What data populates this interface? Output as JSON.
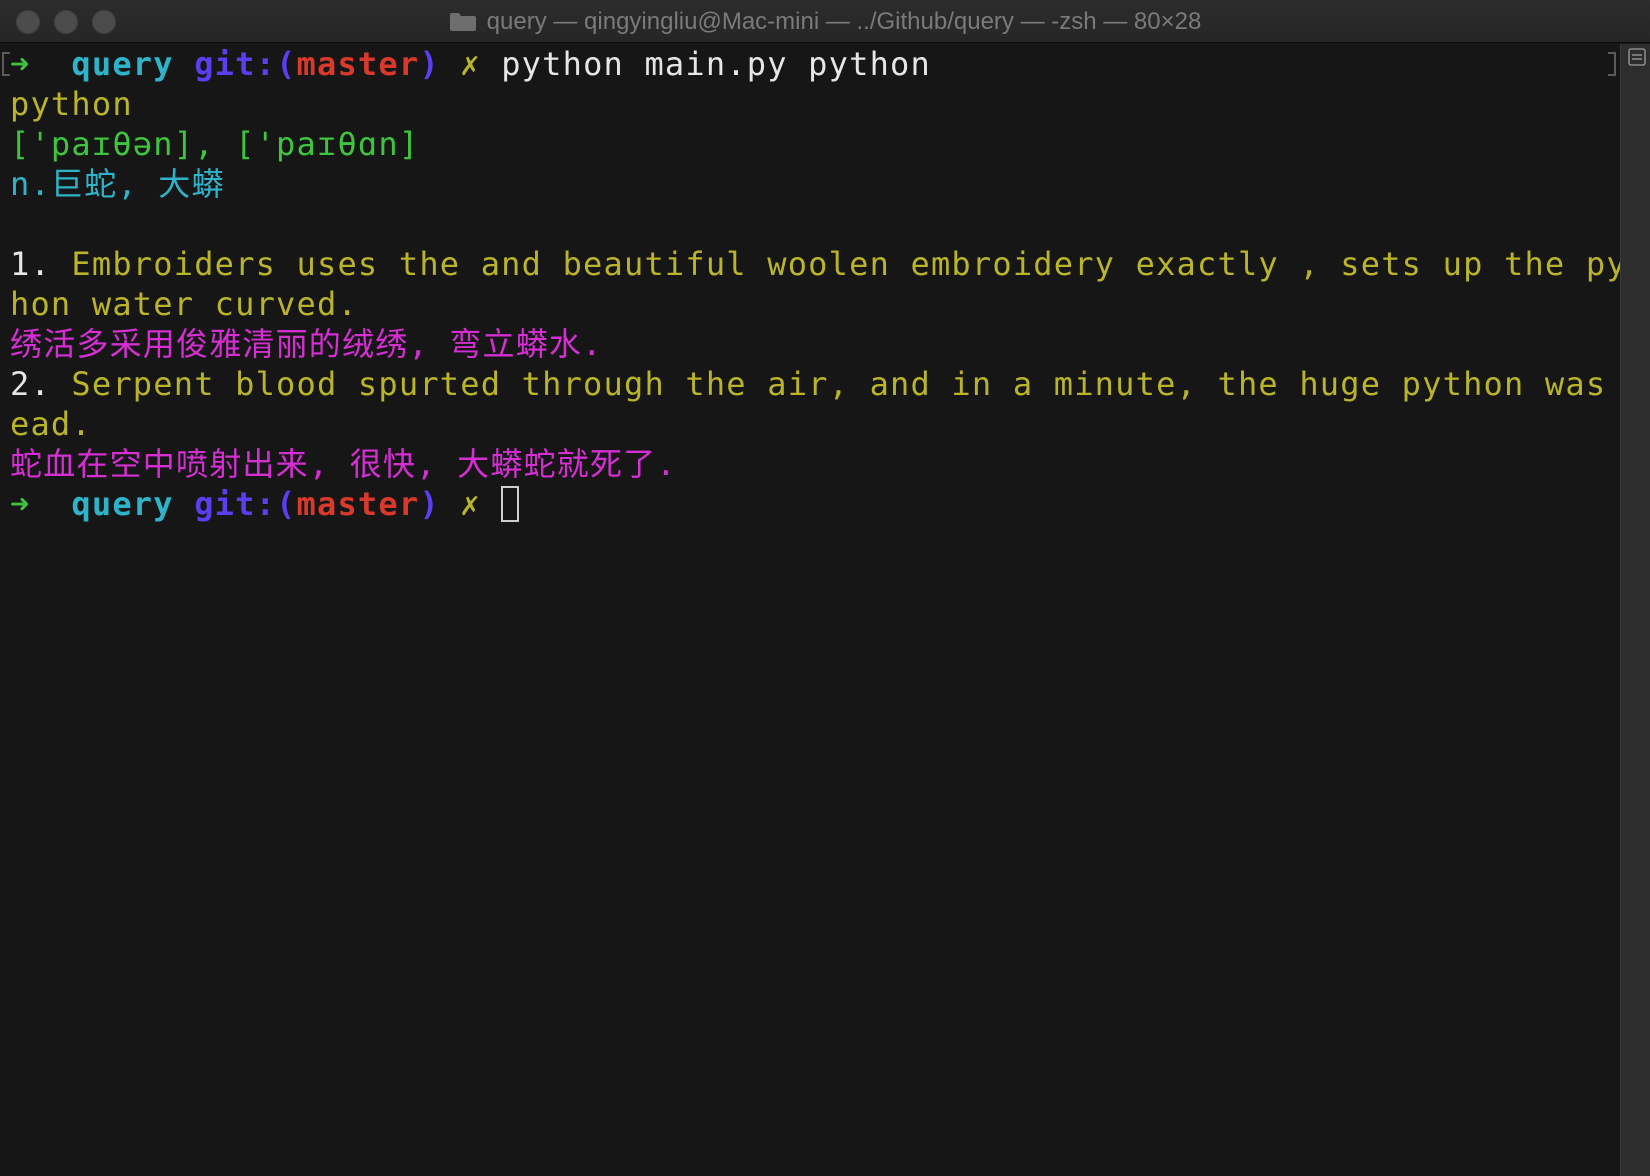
{
  "window": {
    "title": "query — qingyingliu@Mac-mini — ../Github/query — -zsh — 80×28"
  },
  "icons": {
    "folder": "folder-icon",
    "marks": "marks-icon"
  },
  "colors": {
    "background": "#161616",
    "green": "#3ec43e",
    "cyan": "#2fb3c9",
    "blue": "#5a3ef0",
    "red": "#d8392b",
    "yellow": "#b9b42a",
    "magenta": "#d52fd3",
    "white": "#e6e6e6"
  },
  "terminal": {
    "lines": [
      [
        {
          "text": "➜  ",
          "color": "#3ec43e",
          "bold": true
        },
        {
          "text": "query ",
          "color": "#2fb3c9",
          "bold": true
        },
        {
          "text": "git:(",
          "color": "#5a3ef0",
          "bold": true
        },
        {
          "text": "master",
          "color": "#d8392b",
          "bold": true
        },
        {
          "text": ") ",
          "color": "#5a3ef0",
          "bold": true
        },
        {
          "text": "✗ ",
          "color": "#b9b42a",
          "bold": true
        },
        {
          "text": "python main.py python",
          "color": "#e6e6e6",
          "bold": false
        }
      ],
      [
        {
          "text": "python",
          "color": "#b9b42a",
          "bold": false
        }
      ],
      [
        {
          "text": "['paɪθən], ['paɪθɑn]",
          "color": "#3ec43e",
          "bold": false
        }
      ],
      [
        {
          "text": "n.巨蛇, 大蟒",
          "color": "#2fb3c9",
          "bold": false
        }
      ],
      [],
      [
        {
          "text": "1. ",
          "color": "#e6e6e6",
          "bold": false
        },
        {
          "text": "Embroiders uses the and beautiful woolen embroidery exactly , sets up the pyt",
          "color": "#b9b42a",
          "bold": false
        }
      ],
      [
        {
          "text": "hon water curved.",
          "color": "#b9b42a",
          "bold": false
        }
      ],
      [
        {
          "text": "绣活多采用俊雅清丽的绒绣, 弯立蟒水.",
          "color": "#d52fd3",
          "bold": false
        }
      ],
      [
        {
          "text": "2. ",
          "color": "#e6e6e6",
          "bold": false
        },
        {
          "text": "Serpent blood spurted through the air, and in a minute, the huge python was d",
          "color": "#b9b42a",
          "bold": false
        }
      ],
      [
        {
          "text": "ead.",
          "color": "#b9b42a",
          "bold": false
        }
      ],
      [
        {
          "text": "蛇血在空中喷射出来, 很快, 大蟒蛇就死了.",
          "color": "#d52fd3",
          "bold": false
        }
      ],
      [
        {
          "text": "➜  ",
          "color": "#3ec43e",
          "bold": true
        },
        {
          "text": "query ",
          "color": "#2fb3c9",
          "bold": true
        },
        {
          "text": "git:(",
          "color": "#5a3ef0",
          "bold": true
        },
        {
          "text": "master",
          "color": "#d8392b",
          "bold": true
        },
        {
          "text": ") ",
          "color": "#5a3ef0",
          "bold": true
        },
        {
          "text": "✗ ",
          "color": "#b9b42a",
          "bold": true
        }
      ]
    ]
  }
}
